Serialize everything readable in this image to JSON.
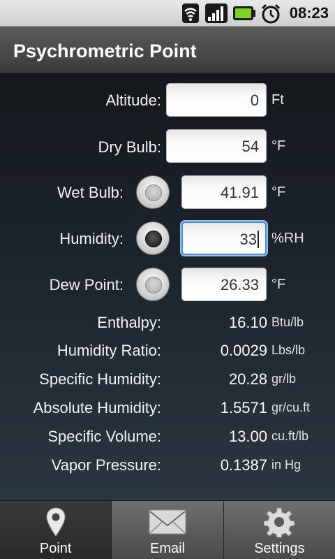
{
  "status_bar": {
    "time": "08:23",
    "icons": [
      "wifi-icon",
      "signal-icon",
      "battery-icon",
      "alarm-clock-icon"
    ]
  },
  "app": {
    "title": "Psychrometric Point"
  },
  "inputs": {
    "altitude": {
      "label": "Altitude:",
      "value": "0",
      "unit": "Ft"
    },
    "dry_bulb": {
      "label": "Dry Bulb:",
      "value": "54",
      "unit": "°F"
    },
    "wet_bulb": {
      "label": "Wet Bulb:",
      "value": "41.91",
      "unit": "°F",
      "radio_selected": false
    },
    "humidity": {
      "label": "Humidity:",
      "value": "33",
      "unit": "%RH",
      "radio_selected": true
    },
    "dew_point": {
      "label": "Dew Point:",
      "value": "26.33",
      "unit": "°F",
      "radio_selected": false
    }
  },
  "results": [
    {
      "label": "Enthalpy:",
      "value": "16.10",
      "unit": "Btu/lb"
    },
    {
      "label": "Humidity Ratio:",
      "value": "0.0029",
      "unit": "Lbs/lb"
    },
    {
      "label": "Specific Humidity:",
      "value": "20.28",
      "unit": "gr/lb"
    },
    {
      "label": "Absolute Humidity:",
      "value": "1.5571",
      "unit": "gr/cu.ft"
    },
    {
      "label": "Specific Volume:",
      "value": "13.00",
      "unit": "cu.ft/lb"
    },
    {
      "label": "Vapor Pressure:",
      "value": "0.1387",
      "unit": "in Hg"
    }
  ],
  "tabs": [
    {
      "label": "Point",
      "icon": "map-pin-icon",
      "selected": true
    },
    {
      "label": "Email",
      "icon": "envelope-icon",
      "selected": false
    },
    {
      "label": "Settings",
      "icon": "gear-icon",
      "selected": false
    }
  ],
  "colors": {
    "focus_border": "#4b8fd6",
    "background": "#1e252b"
  }
}
